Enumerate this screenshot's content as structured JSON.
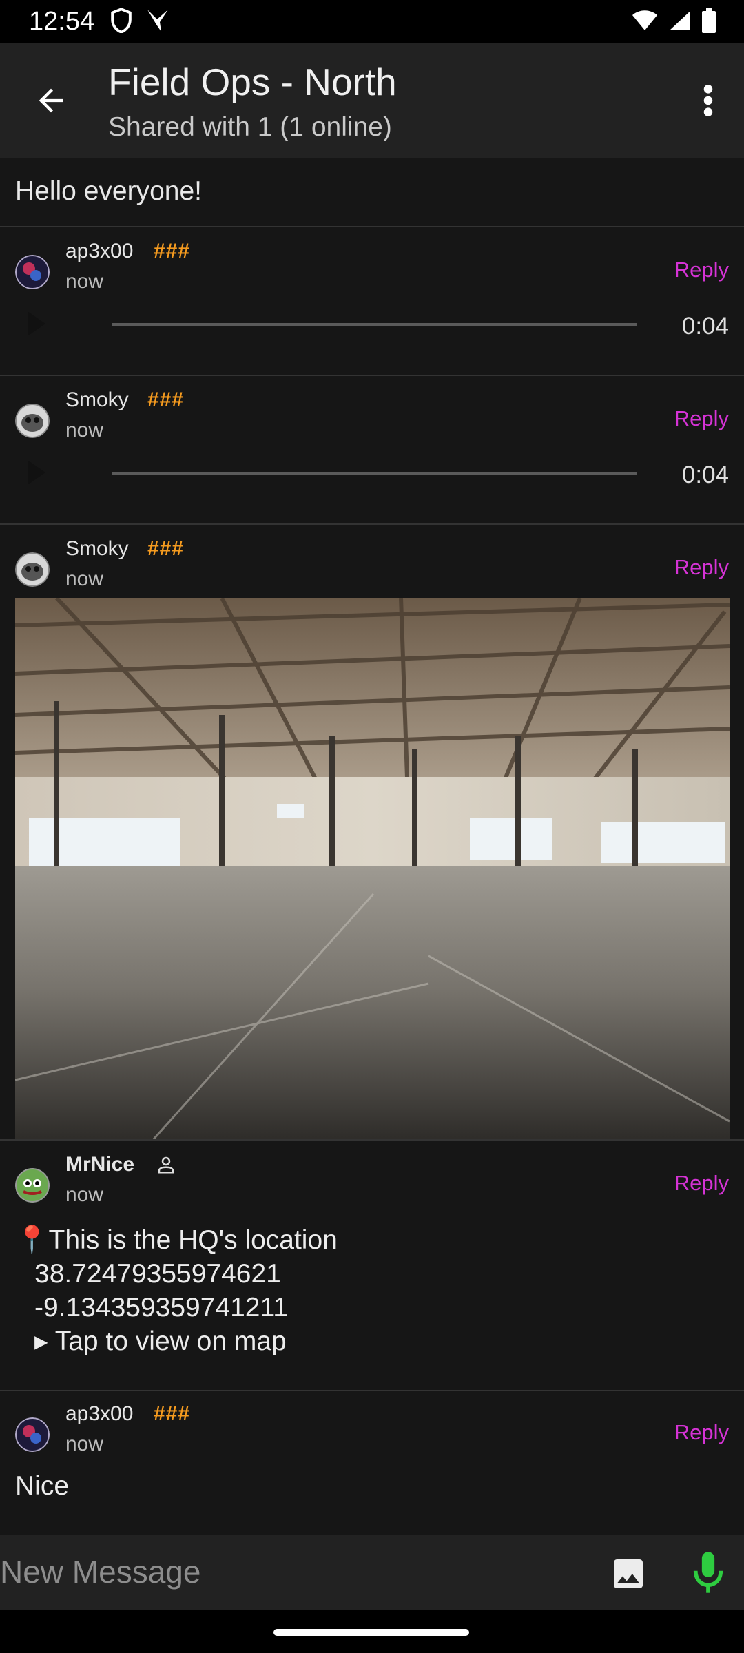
{
  "status_bar": {
    "time": "12:54",
    "left_icons": [
      "shield-icon",
      "drone-icon"
    ],
    "right_icons": [
      "wifi-icon",
      "signal-icon",
      "battery-icon"
    ]
  },
  "app_bar": {
    "title": "Field Ops - North",
    "subtitle": "Shared with 1 (1 online)"
  },
  "pinned_message": "Hello everyone!",
  "messages": [
    {
      "user": "ap3x00",
      "time": "now",
      "rank": "###",
      "reply": "Reply",
      "type": "audio",
      "duration": "0:04"
    },
    {
      "user": "Smoky",
      "time": "now",
      "rank": "###",
      "reply": "Reply",
      "type": "audio",
      "duration": "0:04"
    },
    {
      "user": "Smoky",
      "time": "now",
      "rank": "###",
      "reply": "Reply",
      "type": "image"
    },
    {
      "user": "MrNice",
      "time": "now",
      "reply": "Reply",
      "type": "location",
      "line1": "📍This is the HQ's location",
      "lat": "38.72479355974621",
      "lon": "-9.134359359741211",
      "tap": "▸ Tap to view on map"
    },
    {
      "user": "ap3x00",
      "time": "now",
      "rank": "###",
      "reply": "Reply",
      "type": "text",
      "text": "Nice"
    }
  ],
  "composer": {
    "placeholder": "New Message"
  },
  "colors": {
    "accent": "#d533d5",
    "rank": "#f59b1f",
    "mic": "#2ecc40",
    "background": "#161616"
  }
}
